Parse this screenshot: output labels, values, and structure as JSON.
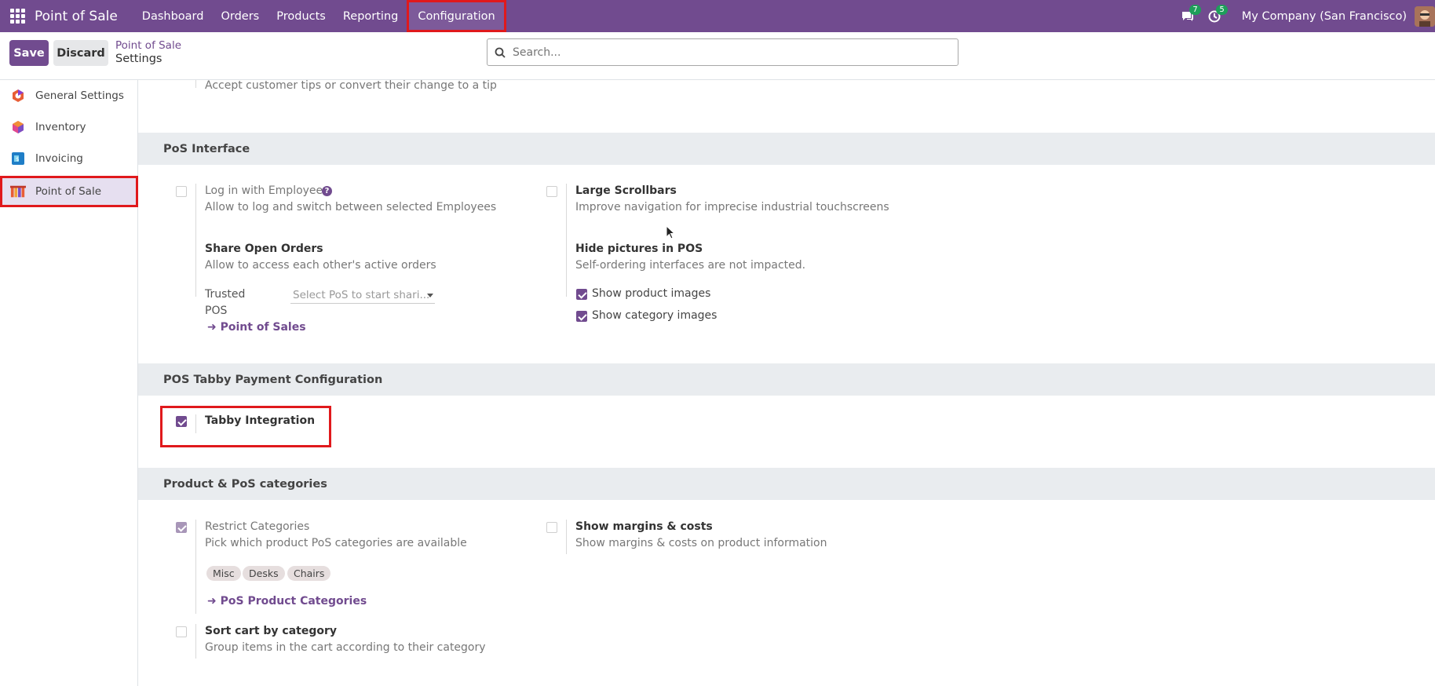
{
  "topnav": {
    "brand": "Point of Sale",
    "menu": [
      "Dashboard",
      "Orders",
      "Products",
      "Reporting",
      "Configuration"
    ],
    "messages_count": "7",
    "activities_count": "5",
    "company": "My Company (San Francisco)"
  },
  "controlbar": {
    "save_label": "Save",
    "discard_label": "Discard",
    "breadcrumb_parent": "Point of Sale",
    "breadcrumb_current": "Settings",
    "search_placeholder": "Search..."
  },
  "sidebar": {
    "items": [
      {
        "label": "General Settings"
      },
      {
        "label": "Inventory"
      },
      {
        "label": "Invoicing"
      },
      {
        "label": "Point of Sale"
      }
    ]
  },
  "content": {
    "tips_desc": "Accept customer tips or convert their change to a tip",
    "pos_interface": {
      "header": "PoS Interface",
      "login_employees_title": "Log in with Employees",
      "login_employees_desc": "Allow to log and switch between selected Employees",
      "large_scrollbars_title": "Large Scrollbars",
      "large_scrollbars_desc": "Improve navigation for imprecise industrial touchscreens",
      "share_orders_title": "Share Open Orders",
      "share_orders_desc": "Allow to access each other's active orders",
      "trusted_label_1": "Trusted",
      "trusted_label_2": "POS",
      "trusted_placeholder": "Select PoS to start shari...",
      "point_of_sales_link": "Point of Sales",
      "hide_pictures_title": "Hide pictures in POS",
      "hide_pictures_desc": "Self-ordering interfaces are not impacted.",
      "show_product_images": "Show product images",
      "show_category_images": "Show category images"
    },
    "tabby": {
      "header": "POS Tabby Payment Configuration",
      "integration_title": "Tabby Integration"
    },
    "categories": {
      "header": "Product & PoS categories",
      "restrict_title": "Restrict Categories",
      "restrict_desc": "Pick which product PoS categories are available",
      "tags": [
        "Misc",
        "Desks",
        "Chairs"
      ],
      "pos_product_categories_link": "PoS Product Categories",
      "margins_title": "Show margins & costs",
      "margins_desc": "Show margins & costs on product information",
      "sort_cart_title": "Sort cart by category",
      "sort_cart_desc": "Group items in the cart according to their category"
    }
  },
  "colors": {
    "brand_purple": "#714b8f",
    "highlight_red": "#e0191c",
    "section_gray": "#e9ecef"
  }
}
